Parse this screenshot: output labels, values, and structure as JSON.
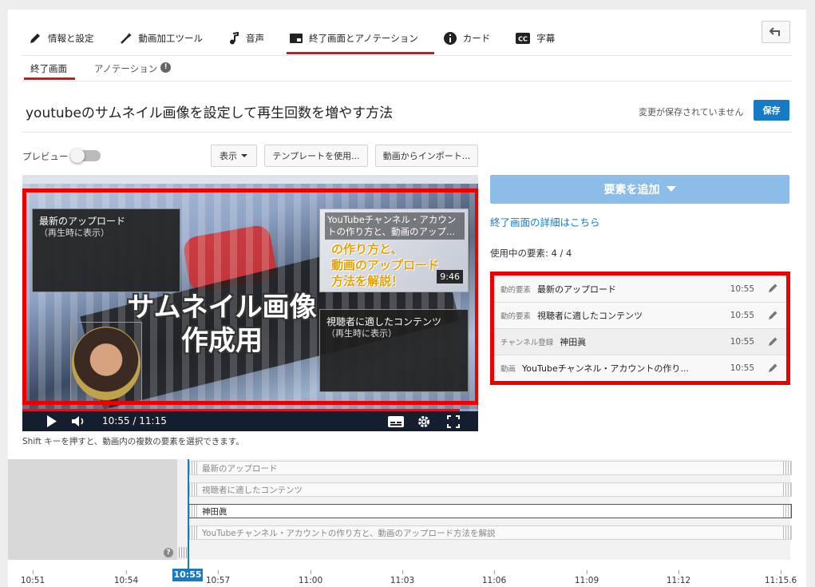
{
  "tabs": [
    {
      "label": "情報と設定",
      "icon": "pencil-icon"
    },
    {
      "label": "動画加工ツール",
      "icon": "magic-wand-icon"
    },
    {
      "label": "音声",
      "icon": "music-note-icon"
    },
    {
      "label": "終了画面とアノテーション",
      "icon": "end-screen-icon",
      "active": true
    },
    {
      "label": "カード",
      "icon": "info-icon"
    },
    {
      "label": "字幕",
      "icon": "cc-icon"
    }
  ],
  "subtabs": {
    "end_screen": "終了画面",
    "annotations": "アノテーション",
    "annotations_badge": "!"
  },
  "header": {
    "title": "youtubeのサムネイル画像を設定して再生回数を増やす方法",
    "unsaved": "変更が保存されていません",
    "save": "保存"
  },
  "controls": {
    "preview": "プレビュー",
    "show": "表示",
    "use_template": "テンプレートを使用...",
    "import_from_video": "動画からインポート..."
  },
  "player": {
    "thumb_text": "サムネイル画像\n作成用",
    "time": "10:55 / 11:15",
    "overlays": {
      "latest_upload": {
        "title": "最新のアップロード",
        "sub": "（再生時に表示）"
      },
      "video": {
        "title": "YouTubeチャンネル・アカウントの作り方と、動画のアップ...",
        "art": "の作り方と、\n動画のアップロード\n方法を解説！",
        "duration": "9:46"
      },
      "viewer": {
        "title": "視聴者に適したコンテンツ",
        "sub": "（再生時に表示）"
      }
    }
  },
  "shift_note": "Shift キーを押すと、動画内の複数の要素を選択できます。",
  "right": {
    "add_element": "要素を追加",
    "details_link": "終了画面の詳細はこちら",
    "elements_used": "使用中の要素: 4 / 4",
    "elements": [
      {
        "type": "動的要素",
        "name": "最新のアップロード",
        "time": "10:55"
      },
      {
        "type": "動的要素",
        "name": "視聴者に適したコンテンツ",
        "time": "10:55"
      },
      {
        "type": "チャンネル登録",
        "name": "神田眞",
        "time": "10:55"
      },
      {
        "type": "動画",
        "name": "YouTubeチャンネル・アカウントの作り...",
        "time": "10:55"
      }
    ]
  },
  "timeline": {
    "tracks": [
      "最新のアップロード",
      "視聴者に適したコンテンツ",
      "神田眞",
      "YouTubeチャンネル・アカウントの作り方と、動画のアップロード方法を解説"
    ],
    "help": "?",
    "current": "10:55",
    "ticks": [
      "10:51",
      "10:54",
      "10:57",
      "11:00",
      "11:03",
      "11:06",
      "11:09",
      "11:12",
      "11:15.6"
    ]
  },
  "colors": {
    "accent_red": "#cc181e",
    "accent_blue": "#167ac6",
    "add_button": "#8bbde8",
    "highlight_frame": "#ee0000"
  }
}
